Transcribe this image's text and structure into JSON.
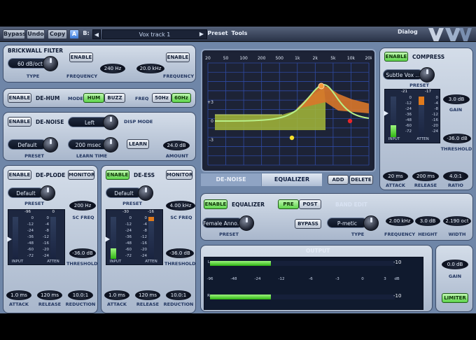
{
  "toolbar": {
    "bypass": "Bypass",
    "undo": "Undo",
    "copy": "Copy",
    "a": "A",
    "b": "B:",
    "prev_arrow": "◀",
    "track_name": "Vox track 1",
    "next_arrow": "▶",
    "preset": "Preset",
    "tools": "Tools",
    "dialog": "Dialog"
  },
  "brickwall": {
    "title": "BRICKWALL FILTER",
    "type_value": "60 dB/oct",
    "type_label": "TYPE",
    "low_enable": "ENABLE",
    "low_freq_value": "240 Hz",
    "low_freq_label": "FREQUENCY",
    "high_enable": "ENABLE",
    "high_freq_value": "20.0 kHz",
    "high_freq_label": "FREQUENCY"
  },
  "dehum": {
    "enable": "ENABLE",
    "title": "DE-HUM",
    "mode_label": "MODE",
    "mode_hum": "HUM",
    "mode_buzz": "BUZZ",
    "freq_label": "FREQ",
    "freq_50": "50Hz",
    "freq_60": "60Hz"
  },
  "denoise": {
    "enable": "ENABLE",
    "title": "DE-NOISE",
    "disp_value": "Left",
    "disp_label": "DISP MODE",
    "preset_value": "Default",
    "preset_label": "PRESET",
    "learn_value": "200 msec",
    "learn_label": "LEARN TIME",
    "learn_button": "LEARN",
    "amount_value": "24.0 dB",
    "amount_label": "AMOUNT"
  },
  "deplode": {
    "enable": "ENABLE",
    "title": "DE-PLODE",
    "monitor": "MONITOR",
    "preset_value": "Default",
    "preset_label": "PRESET",
    "scfreq_value": "200 Hz",
    "scfreq_label": "SC FREQ",
    "input_peak": "-96",
    "atten_peak": "0",
    "scale": [
      "0",
      "-12",
      "-24",
      "-36",
      "-48",
      "-60",
      "-72"
    ],
    "atten_scale": [
      "0",
      "-4",
      "-8",
      "-12",
      "-16",
      "-20",
      "-24"
    ],
    "input_label": "INPUT",
    "atten_label": "ATTEN",
    "threshold_value": "-36.0 dB",
    "threshold_label": "THRESHOLD",
    "attack_value": "1.0 ms",
    "attack_label": "ATTACK",
    "release_value": "120 ms",
    "release_label": "RELEASE",
    "reduction_value": "10.0:1",
    "reduction_label": "REDUCTION"
  },
  "deess": {
    "enable": "ENABLE",
    "title": "DE-ESS",
    "monitor": "MONITOR",
    "preset_value": "Default",
    "preset_label": "PRESET",
    "scfreq_value": "4.00 kHz",
    "scfreq_label": "SC FREQ",
    "input_peak": "-30",
    "atten_peak": "-16",
    "scale": [
      "0",
      "-12",
      "-24",
      "-36",
      "-48",
      "-60",
      "-72"
    ],
    "atten_scale": [
      "0",
      "-4",
      "-8",
      "-12",
      "-16",
      "-20",
      "-24"
    ],
    "input_label": "INPUT",
    "atten_label": "ATTEN",
    "threshold_value": "-36.0 dB",
    "threshold_label": "THRESHOLD",
    "attack_value": "1.0 ms",
    "attack_label": "ATTACK",
    "release_value": "120 ms",
    "release_label": "RELEASE",
    "reduction_value": "10.0:1",
    "reduction_label": "REDUCTION",
    "input_level": 0.25,
    "atten_level": 0.1
  },
  "eq": {
    "freq_labels": [
      "20",
      "50",
      "100",
      "200",
      "500",
      "1k",
      "2k",
      "5k",
      "10k",
      "20k"
    ],
    "db_labels": [
      "+3",
      "0",
      "-3"
    ],
    "tab_denoise": "DE-NOISE",
    "tab_equalizer": "EQUALIZER",
    "add": "ADD",
    "delete": "DELETE",
    "enable": "ENABLE",
    "title": "EQUALIZER",
    "pre": "PRE",
    "post": "POST",
    "preset_value": "Female Anno...",
    "preset_label": "PRESET",
    "bypass": "BYPASS",
    "band_edit": "BAND EDIT",
    "type_value": "P-metic",
    "type_label": "TYPE",
    "freq_value": "2.00 kHz",
    "freq_label": "FREQUENCY",
    "height_value": "3.0 dB",
    "height_label": "HEIGHT",
    "width_value": "2.190 oct",
    "width_label": "WIDTH",
    "colors": {
      "fill_low": "#a5b838",
      "fill_high": "#d9772a",
      "curve": "#b9f088",
      "grid": "#2f4aa3"
    }
  },
  "compress": {
    "enable": "ENABLE",
    "title": "COMPRESS",
    "preset_value": "Subtle Vox ...",
    "preset_label": "PRESET",
    "input_peak": "-21",
    "atten_peak": "-17",
    "scale": [
      "0",
      "-12",
      "-24",
      "-36",
      "-48",
      "-60",
      "-72"
    ],
    "atten_scale": [
      "0",
      "-4",
      "-8",
      "-12",
      "-16",
      "-20",
      "-24"
    ],
    "input_label": "INPUT",
    "atten_label": "ATTEN",
    "gain_value": "3.0 dB",
    "gain_label": "GAIN",
    "threshold_value": "-36.0 dB",
    "threshold_label": "THRESHOLD",
    "attack_value": "20 ms",
    "attack_label": "ATTACK",
    "release_value": "200 ms",
    "release_label": "RELEASE",
    "ratio_value": "4.0:1",
    "ratio_label": "RATIO",
    "input_level": 0.3,
    "atten_level": 0.2
  },
  "output": {
    "title": "OUTPUT",
    "scale": [
      "-96",
      "-48",
      "-24",
      "-12",
      "-6",
      "-3",
      "0",
      "3"
    ],
    "db": "dB",
    "left_peak": "-10",
    "right_peak": "-10",
    "ch_l": "L",
    "ch_r": "R",
    "gain_value": "0.0 dB",
    "gain_label": "GAIN",
    "limiter": "LIMITER",
    "left_level": 0.33,
    "right_level": 0.33
  }
}
